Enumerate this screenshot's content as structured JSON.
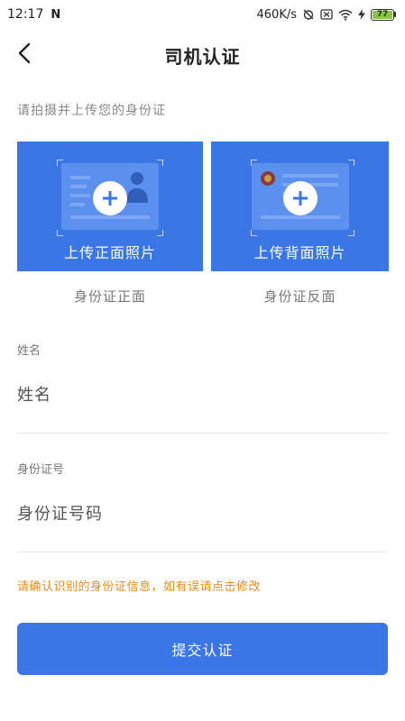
{
  "status_bar": {
    "time": "12:17",
    "notification_icon": "N",
    "network_speed": "460K/s",
    "battery_level": "77",
    "battery_color": "#8bc34a"
  },
  "header": {
    "title": "司机认证",
    "back_icon": "chevron-left-icon"
  },
  "instruction": "请拍摄并上传您的身份证",
  "id_cards": {
    "front": {
      "label": "上传正面照片",
      "caption": "身份证正面"
    },
    "back": {
      "label": "上传背面照片",
      "caption": "身份证反面"
    }
  },
  "form": {
    "name": {
      "label": "姓名",
      "placeholder": "姓名",
      "value": ""
    },
    "id_number": {
      "label": "身份证号",
      "placeholder": "身份证号码",
      "value": ""
    }
  },
  "warning": "请确认识别的身份证信息，如有误请点击修改",
  "submit_label": "提交认证",
  "colors": {
    "primary": "#3a76e6",
    "warning": "#f08a1c"
  }
}
